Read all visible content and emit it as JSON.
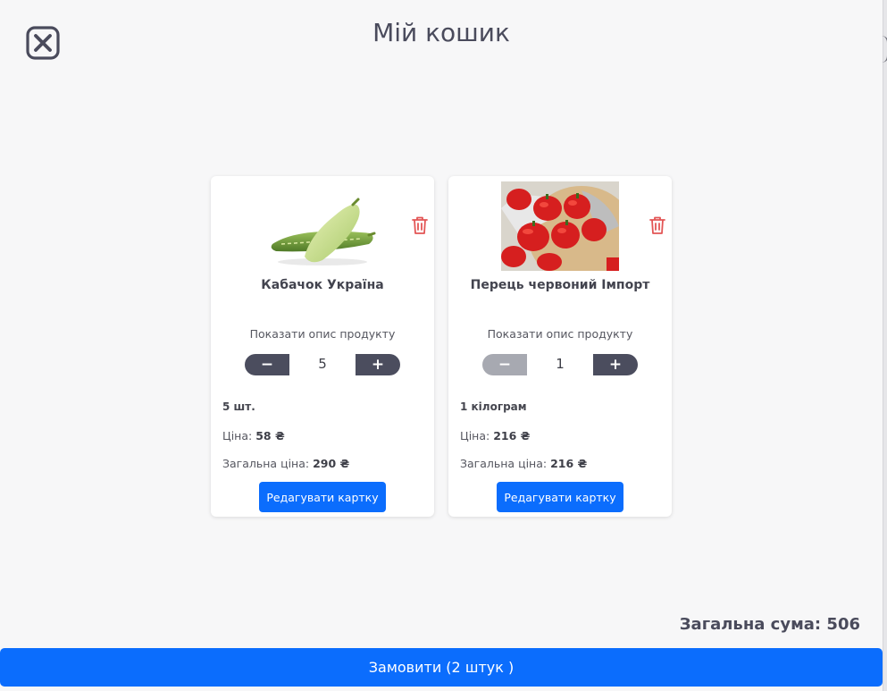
{
  "title": "Мій кошик",
  "colors": {
    "primary": "#0b6dfd",
    "dark": "#4b4d5e",
    "danger": "#e35555",
    "disabled": "#a7a9b1"
  },
  "icons": {
    "close": "close-x-icon",
    "delete": "trash-icon",
    "decrement": "minus-icon",
    "increment": "plus-icon"
  },
  "cart": [
    {
      "name": "Кабачок Україна",
      "image": "zucchini-photo",
      "description_link": "Показати опис продукту",
      "quantity": "5",
      "decrement_label": "−",
      "increment_label": "+",
      "decrement_disabled": false,
      "unit": "5 шт.",
      "price_label": "Ціна:",
      "price": "58 ₴",
      "total_label": "Загальна ціна:",
      "total": "290 ₴",
      "edit_label": "Редагувати картку"
    },
    {
      "name": "Перець червоний Імпорт",
      "image": "red-pepper-photo",
      "description_link": "Показати опис продукту",
      "quantity": "1",
      "decrement_label": "−",
      "increment_label": "+",
      "decrement_disabled": true,
      "unit": "1 кілограм",
      "price_label": "Ціна:",
      "price": "216 ₴",
      "total_label": "Загальна ціна:",
      "total": "216 ₴",
      "edit_label": "Редагувати картку"
    }
  ],
  "summary": {
    "label": "Загальна сума:",
    "value": "506"
  },
  "order_button": "Замовити (2 штук )"
}
